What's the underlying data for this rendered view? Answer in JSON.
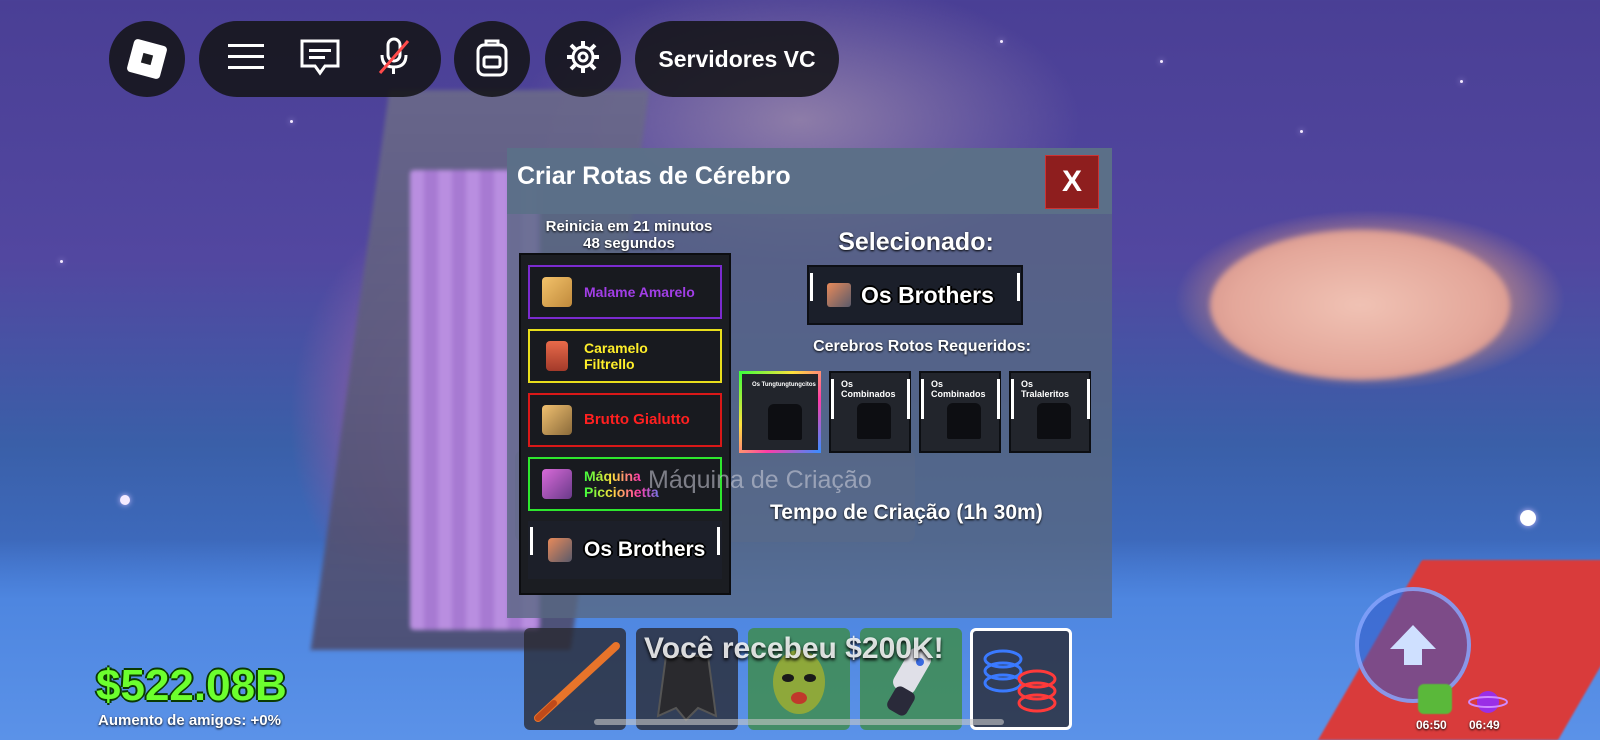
{
  "top_bar": {
    "vc_servers_label": "Servidores VC"
  },
  "craft_panel": {
    "title": "Criar Rotas de Cérebro",
    "close_label": "X",
    "reset_timer": [
      "Reinicia em 21 minutos",
      "48 segundos"
    ],
    "recipes": [
      {
        "name": "Malame Amarelo",
        "color": "#a13ee6",
        "border": "#7b2bd0"
      },
      {
        "name": "Caramelo Filtrello",
        "color": "#ffef2a",
        "border": "#e8de1c"
      },
      {
        "name": "Brutto Gialutto",
        "color": "#ff2020",
        "border": "#d91818"
      },
      {
        "name": "Máquina Piccionetta",
        "color": "rainbow",
        "border": "#2ee62e"
      },
      {
        "name": "Os Brothers",
        "color": "#ffffff",
        "border": "#000000"
      }
    ],
    "selected_heading": "Selecionado:",
    "selected_name": "Os Brothers",
    "required_heading": "Cerebros Rotos Requeridos:",
    "required": [
      {
        "name": "Os Tungtungtungcitos",
        "highlight": true
      },
      {
        "name": "Os Combinados",
        "highlight": false
      },
      {
        "name": "Os Combinados",
        "highlight": false
      },
      {
        "name": "Os Tralaleritos",
        "highlight": false
      }
    ],
    "ghost_label": "Máquina de Criação",
    "craft_time": "Tempo de Criação (1h 30m)"
  },
  "hotbar": {
    "toast": "Você recebeu $200K!",
    "slots": [
      "bat",
      "cape",
      "mask",
      "gloves",
      "coil"
    ],
    "active_slot": 4
  },
  "stats": {
    "money": "$522.08B",
    "friend_boost": "Aumento de amigos: +0%"
  },
  "timers": [
    "06:50",
    "06:49"
  ],
  "colors": {
    "money": "#6cff2e",
    "close_button": "#8e1e1e",
    "panel": "#58688a"
  }
}
